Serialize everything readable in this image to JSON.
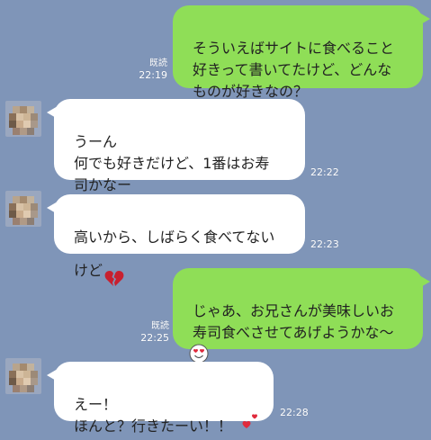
{
  "messages": [
    {
      "side": "out",
      "text": "そういえばサイトに食べること\n好きって書いてたけど、どんな\nものが好きなの？",
      "read": "既読",
      "time": "22:19"
    },
    {
      "side": "in",
      "text": "うーん\n何でも好きだけど、1番はお寿\n司かなー",
      "time": "22:22"
    },
    {
      "side": "in",
      "text": "高いから、しばらく食べてない\nけど",
      "emoji": "broken-heart-icon",
      "time": "22:23"
    },
    {
      "side": "out",
      "text": "じゃあ、お兄さんが美味しいお\n寿司食べさせてあげようかな〜",
      "emoji": "heart-eyes-face-icon",
      "read": "既読",
      "time": "22:25"
    },
    {
      "side": "in",
      "text": "えー！\nほんと？行きたーい！！",
      "emoji": "two-hearts-icon",
      "time": "22:28"
    }
  ],
  "colors": {
    "background": "#7f95b8",
    "outgoing_bubble": "#8fde57",
    "incoming_bubble": "#ffffff",
    "emoji_red": "#e02a3c"
  }
}
